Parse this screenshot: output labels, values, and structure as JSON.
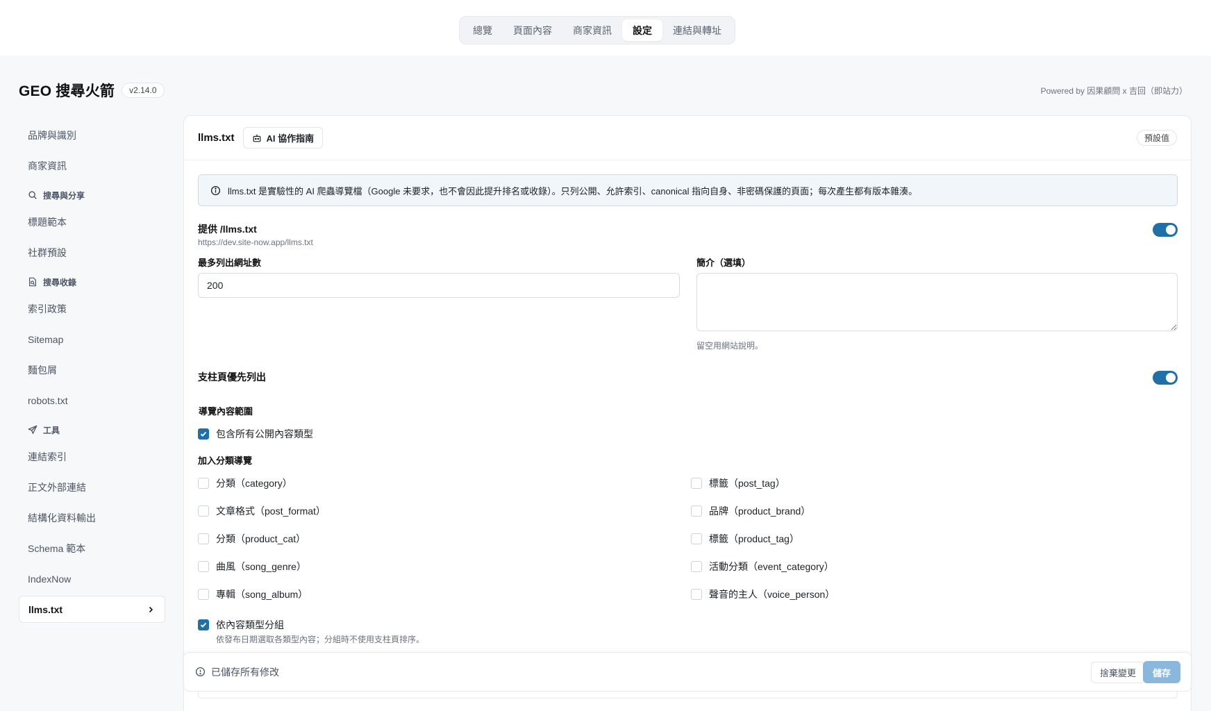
{
  "top_tabs": [
    {
      "label": "總覽",
      "active": false
    },
    {
      "label": "頁面內容",
      "active": false
    },
    {
      "label": "商家資訊",
      "active": false
    },
    {
      "label": "設定",
      "active": true
    },
    {
      "label": "連結與轉址",
      "active": false
    }
  ],
  "brand": {
    "title": "GEO 搜尋火箭",
    "version": "v2.14.0"
  },
  "powered_by": "Powered by 因果顧問 x 吉回（即站力）",
  "sidebar": {
    "items_top": [
      "品牌與識別",
      "商家資訊"
    ],
    "section_search_share": {
      "title": "搜尋與分享",
      "icon": "search-icon",
      "items": [
        "標題範本",
        "社群預設"
      ]
    },
    "section_indexing": {
      "title": "搜尋收錄",
      "icon": "document-search-icon",
      "items": [
        "索引政策",
        "Sitemap",
        "麵包屑",
        "robots.txt"
      ]
    },
    "section_tools": {
      "title": "工具",
      "icon": "send-icon",
      "items": [
        "連結索引",
        "正文外部連結",
        "結構化資料輸出",
        "Schema 範本",
        "IndexNow"
      ]
    },
    "active_item": "llms.txt"
  },
  "card": {
    "title": "llms.txt",
    "guide_button": "AI 協作指南",
    "default_button": "預設值",
    "notice": "llms.txt 是實驗性的 AI 爬蟲導覽檔（Google 未要求，也不會因此提升排名或收錄）。只列公開、允許索引、canonical 指向自身、非密碼保護的頁面；每次產生都有版本雜湊。",
    "serve": {
      "label": "提供 /llms.txt",
      "url": "https://dev.site-now.app/llms.txt",
      "enabled": true
    },
    "max_urls": {
      "label": "最多列出網址數",
      "value": "200"
    },
    "intro": {
      "label": "簡介（選填）",
      "value": "",
      "hint": "留空用網站說明。"
    },
    "pillar_first": {
      "label": "支柱頁優先列出",
      "enabled": true
    },
    "scope": {
      "label": "導覽內容範圍",
      "include_all": {
        "label": "包含所有公開內容類型",
        "checked": true
      }
    },
    "taxonomies": {
      "label": "加入分類導覽",
      "left": [
        {
          "label": "分類（category）",
          "checked": false
        },
        {
          "label": "文章格式（post_format）",
          "checked": false
        },
        {
          "label": "分類（product_cat）",
          "checked": false
        },
        {
          "label": "曲風（song_genre）",
          "checked": false
        },
        {
          "label": "專輯（song_album）",
          "checked": false
        }
      ],
      "right": [
        {
          "label": "標籤（post_tag）",
          "checked": false
        },
        {
          "label": "品牌（product_brand）",
          "checked": false
        },
        {
          "label": "標籤（product_tag）",
          "checked": false
        },
        {
          "label": "活動分類（event_category）",
          "checked": false
        },
        {
          "label": "聲音的主人（voice_person）",
          "checked": false
        }
      ]
    },
    "group_by_type": {
      "label": "依內容類型分組",
      "checked": true,
      "hint": "依發布日期選取各類型內容；分組時不使用支柱頁排序。"
    }
  },
  "footer": {
    "status": "已儲存所有修改",
    "discard": "捨棄變更",
    "save": "儲存"
  },
  "colors": {
    "accent": "#1f6fa8",
    "save_disabled": "#8ab8dc",
    "notice_bg": "#f1f6fa"
  }
}
